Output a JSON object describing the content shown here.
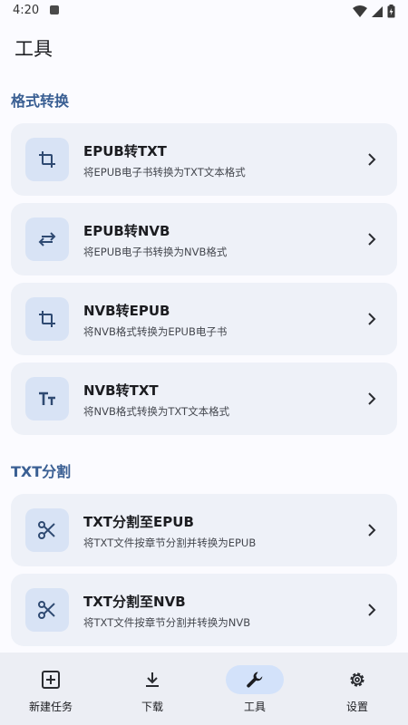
{
  "status_bar": {
    "time": "4:20"
  },
  "page": {
    "title": "工具"
  },
  "sections": [
    {
      "header": "格式转换",
      "items": [
        {
          "title": "EPUB转TXT",
          "subtitle": "将EPUB电子书转换为TXT文本格式",
          "icon": "crop-icon"
        },
        {
          "title": "EPUB转NVB",
          "subtitle": "将EPUB电子书转换为NVB格式",
          "icon": "swap-icon"
        },
        {
          "title": "NVB转EPUB",
          "subtitle": "将NVB格式转换为EPUB电子书",
          "icon": "crop-icon"
        },
        {
          "title": "NVB转TXT",
          "subtitle": "将NVB格式转换为TXT文本格式",
          "icon": "text-size-icon"
        }
      ]
    },
    {
      "header": "TXT分割",
      "items": [
        {
          "title": "TXT分割至EPUB",
          "subtitle": "将TXT文件按章节分割并转换为EPUB",
          "icon": "scissors-icon"
        },
        {
          "title": "TXT分割至NVB",
          "subtitle": "将TXT文件按章节分割并转换为NVB",
          "icon": "scissors-icon"
        }
      ]
    }
  ],
  "bottom_nav": {
    "items": [
      {
        "label": "新建任务",
        "icon": "add-box-icon",
        "active": false
      },
      {
        "label": "下载",
        "icon": "download-icon",
        "active": false
      },
      {
        "label": "工具",
        "icon": "wrench-icon",
        "active": true
      },
      {
        "label": "设置",
        "icon": "gear-icon",
        "active": false
      }
    ]
  },
  "colors": {
    "accent": "#3a5f93",
    "card_bg": "#eef1f8",
    "icon_box_bg": "#d8e3f5",
    "nav_active_bg": "#d3e2fa"
  }
}
